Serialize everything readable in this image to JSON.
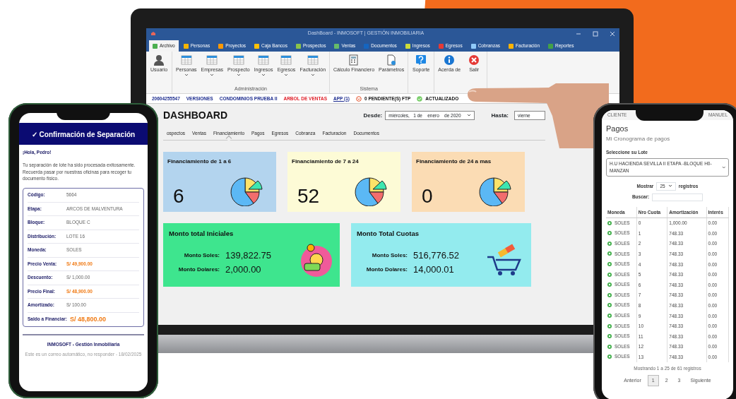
{
  "laptop_app": {
    "window": {
      "title": "DashBoard - INMOSOFT | GESTIÓN INMOBILIARIA"
    },
    "menu_tabs": [
      {
        "label": "Archivo",
        "selected": true,
        "color": "#4caf50"
      },
      {
        "label": "Personas",
        "selected": false,
        "color": "#f4b400"
      },
      {
        "label": "Proyectos",
        "selected": false,
        "color": "#ff9800"
      },
      {
        "label": "Caja Bancos",
        "selected": false,
        "color": "#ffc107"
      },
      {
        "label": "Prospectos",
        "selected": false,
        "color": "#8bc34a"
      },
      {
        "label": "Ventas",
        "selected": false,
        "color": "#66bb6a"
      },
      {
        "label": "Documentos",
        "selected": false,
        "color": "#1565c0"
      },
      {
        "label": "Ingresos",
        "selected": false,
        "color": "#cddc39"
      },
      {
        "label": "Egresos",
        "selected": false,
        "color": "#e53935"
      },
      {
        "label": "Cobranzas",
        "selected": false,
        "color": "#90caf9"
      },
      {
        "label": "Facturación",
        "selected": false,
        "color": "#ffb300"
      },
      {
        "label": "Reportes",
        "selected": false,
        "color": "#43a047"
      }
    ],
    "ribbon_groups": [
      {
        "buttons": [
          {
            "label": "Usuario",
            "kind": "user",
            "dropdown": false
          }
        ]
      },
      {
        "label": "Administración",
        "buttons": [
          {
            "label": "Personas",
            "kind": "table",
            "dropdown": true
          },
          {
            "label": "Empresas",
            "kind": "table",
            "dropdown": true
          },
          {
            "label": "Prospecto",
            "kind": "table",
            "dropdown": true
          },
          {
            "label": "Ingresos",
            "kind": "table",
            "dropdown": true
          },
          {
            "label": "Egresos",
            "kind": "table",
            "dropdown": true
          },
          {
            "label": "Facturación",
            "kind": "table",
            "dropdown": true
          }
        ]
      },
      {
        "label": "Sistema",
        "buttons": [
          {
            "label": "Cálculo Financiero",
            "kind": "calculator",
            "dropdown": false
          },
          {
            "label": "Parámetros",
            "kind": "settings",
            "dropdown": false
          }
        ]
      },
      {
        "buttons": [
          {
            "label": "Soporte",
            "kind": "help",
            "dropdown": false
          }
        ]
      },
      {
        "buttons": [
          {
            "label": "Acerda de",
            "kind": "info",
            "dropdown": false
          },
          {
            "label": "Salir",
            "kind": "exit",
            "dropdown": false
          }
        ]
      }
    ],
    "status_items": [
      {
        "text": "20604255547",
        "kind": "info"
      },
      {
        "text": "VERSIONES",
        "kind": "info"
      },
      {
        "text": "CONDOMINIOS PRUEBA II",
        "kind": "info"
      },
      {
        "text": "ARBOL DE VENTAS",
        "kind": "alert"
      },
      {
        "text": "APP (1)",
        "kind": "link"
      },
      {
        "text": "0 PENDIENTE(S) FTP",
        "kind": "pending"
      },
      {
        "text": "ACTUALIZADO",
        "kind": "ok"
      }
    ],
    "dashboard": {
      "title": "DASHBOARD",
      "from_label": "Desde:",
      "from_value": "miércoles,   1 de    enero    de 2020",
      "to_label": "Hasta:",
      "to_value": "vierne",
      "tabs": [
        {
          "label": "ospectos",
          "selected": false
        },
        {
          "label": "Ventas",
          "selected": false
        },
        {
          "label": "Financiamiento",
          "selected": true
        },
        {
          "label": "Pagos",
          "selected": false
        },
        {
          "label": "Egresos",
          "selected": false
        },
        {
          "label": "Cobranza",
          "selected": false
        },
        {
          "label": "Facturacion",
          "selected": false
        },
        {
          "label": "Documentos",
          "selected": false
        }
      ],
      "count_cards": [
        {
          "title": "Financiamiento de 1 a 6",
          "value": "6",
          "color": "#b3d4ee"
        },
        {
          "title": "Financiamiento de 7 a 24",
          "value": "52",
          "color": "#fdfbd6"
        },
        {
          "title": "Financiamiento de 24 a mas",
          "value": "0",
          "color": "#fbdcb4"
        }
      ],
      "amount_cards": [
        {
          "title": "Monto total Iniciales",
          "color": "#3ee58e",
          "kind": "money",
          "rows": [
            {
              "label": "Monto Soles:",
              "value": "139,822.75"
            },
            {
              "label": "Monto Dolares:",
              "value": "2,000.00"
            }
          ]
        },
        {
          "title": "Monto Total Cuotas",
          "color": "#93ebee",
          "kind": "cart",
          "rows": [
            {
              "label": "Monto Soles:",
              "value": "516,776.52"
            },
            {
              "label": "Monto Dolares:",
              "value": "14,000.01"
            }
          ]
        }
      ]
    }
  },
  "confirmation_phone": {
    "title": "✓ Confirmación de Separación",
    "greeting": "¡Hola, Pedro!",
    "message": "Tu separación de lote ha sido procesada exitosamente. Recuerda pasar por nuestras oficinas para recoger tu documento físico.",
    "fields": [
      {
        "label": "Código:",
        "value": "5664",
        "highlight": false
      },
      {
        "label": "Etapa:",
        "value": "ARCOS DE MALVENTURA",
        "highlight": false
      },
      {
        "label": "Bloque:",
        "value": "BLOQUE C",
        "highlight": false
      },
      {
        "label": "Distribución:",
        "value": "LOTE 16",
        "highlight": false
      },
      {
        "label": "Moneda:",
        "value": "SOLES",
        "highlight": false
      },
      {
        "label": "Precio Venta:",
        "value": "S/ 49,900.00",
        "highlight": true
      },
      {
        "label": "Descuento:",
        "value": "S/ 1,000.00",
        "highlight": false
      },
      {
        "label": "Precio Final:",
        "value": "S/ 48,900.00",
        "highlight": true
      },
      {
        "label": "Amortizado:",
        "value": "S/ 100.00",
        "highlight": false
      }
    ],
    "total": {
      "label": "Saldo a Financiar:",
      "value": "S/ 48,800.00"
    },
    "footer_title": "INMOSOFT - Gestión Inmobiliaria",
    "footer_note": "Este es un correo automático, no responder - 18/02/2025"
  },
  "payments_phone": {
    "top_left": "CLIENTE",
    "top_right": "MANUEL",
    "title": "Pagos",
    "subtitle": "Mi Cronograma de pagos",
    "lot_label": "Seleccione su Lote",
    "lot_value": "H.U HACIENDA SEVILLA II ETAPA -BLOQUE H0-MANZAN",
    "show_label": "Mostrar",
    "page_size": "25",
    "records_label": "registros",
    "search_label": "Buscar:",
    "columns": [
      "Moneda",
      "Nro Cuota",
      "Amortización",
      "Interés"
    ],
    "rows": [
      [
        "SOLES",
        "0",
        "1,000.00",
        "0.00"
      ],
      [
        "SOLES",
        "1",
        "748.33",
        "0.00"
      ],
      [
        "SOLES",
        "2",
        "748.33",
        "0.00"
      ],
      [
        "SOLES",
        "3",
        "748.33",
        "0.00"
      ],
      [
        "SOLES",
        "4",
        "748.33",
        "0.00"
      ],
      [
        "SOLES",
        "5",
        "748.33",
        "0.00"
      ],
      [
        "SOLES",
        "6",
        "748.33",
        "0.00"
      ],
      [
        "SOLES",
        "7",
        "748.33",
        "0.00"
      ],
      [
        "SOLES",
        "8",
        "748.33",
        "0.00"
      ],
      [
        "SOLES",
        "9",
        "748.33",
        "0.00"
      ],
      [
        "SOLES",
        "10",
        "748.33",
        "0.00"
      ],
      [
        "SOLES",
        "11",
        "748.33",
        "0.00"
      ],
      [
        "SOLES",
        "12",
        "748.33",
        "0.00"
      ],
      [
        "SOLES",
        "13",
        "748.33",
        "0.00"
      ]
    ],
    "summary": "Mostrando 1 a 25 de 61 registros",
    "pagination": [
      {
        "label": "Anterior",
        "selected": false
      },
      {
        "label": "1",
        "selected": true
      },
      {
        "label": "2",
        "selected": false
      },
      {
        "label": "3",
        "selected": false
      },
      {
        "label": "Siguiente",
        "selected": false
      }
    ]
  }
}
